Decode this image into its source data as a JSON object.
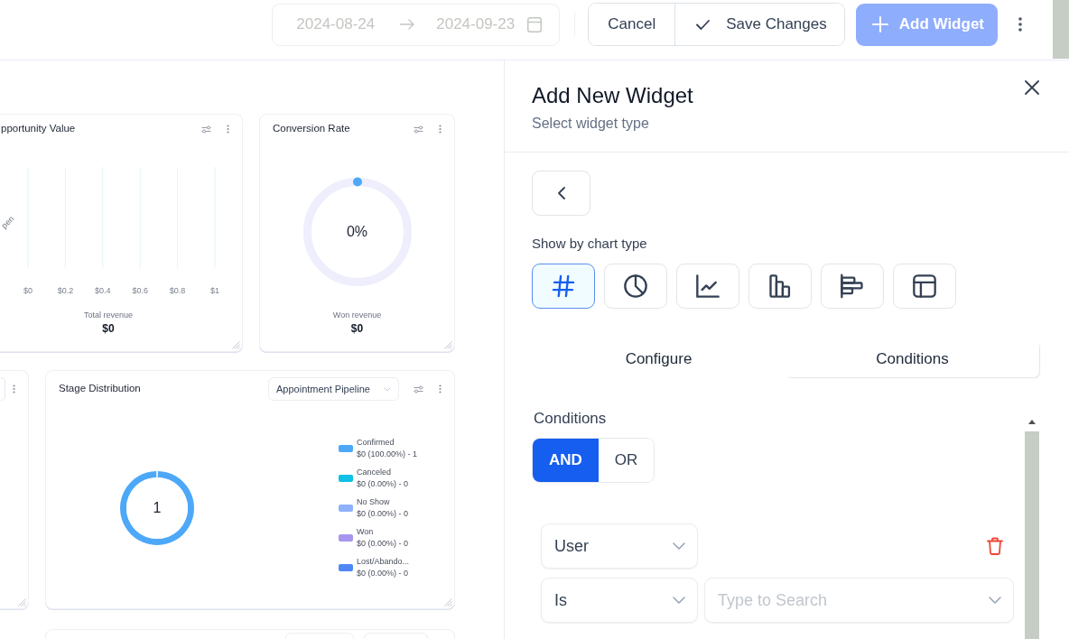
{
  "toolbar": {
    "date_range": {
      "start": "2024-08-24",
      "end": "2024-09-23",
      "disabled": true
    },
    "edit_buttons": [
      {
        "label": "Cancel",
        "kind": "text"
      },
      {
        "label": "Save Changes",
        "kind": "check"
      }
    ],
    "add_button": {
      "label": "Add Widget",
      "disabled": true
    }
  },
  "dashboard": {
    "rows": [
      [
        {
          "kind": "bar",
          "title": "pportunity Value",
          "chart_data": {
            "type": "bar",
            "orientation": "horizontal",
            "grid": true,
            "categories": [
              "pen"
            ],
            "values": [
              0
            ],
            "xlim": [
              0,
              1
            ],
            "xticks": [
              {
                "value": 0,
                "label": "$0"
              },
              {
                "value": 0.2,
                "label": "$0.2"
              },
              {
                "value": 0.4,
                "label": "$0.4"
              },
              {
                "value": 0.6,
                "label": "$0.6"
              },
              {
                "value": 0.8,
                "label": "$0.8"
              },
              {
                "value": 1,
                "label": "$1"
              }
            ]
          },
          "caption": "Total revenue",
          "value": "$0"
        },
        {
          "kind": "gauge",
          "title": "Conversion Rate",
          "reading": "0%",
          "caption": "Won revenue",
          "value": "$0"
        }
      ],
      [
        {
          "kind": "cut"
        },
        {
          "kind": "donut",
          "title": "Stage Distribution",
          "pipeline": "Appointment Pipeline",
          "total": "1",
          "chart_data": {
            "type": "donut",
            "categories": [
              "Confirmed",
              "Canceled",
              "No Show",
              "Won",
              "Lost/Abando..."
            ],
            "values": [
              1,
              0,
              0,
              0,
              0
            ]
          },
          "legend": [
            {
              "color": "#4ea8f8",
              "detail": "$0 (100.00%) - 1"
            },
            {
              "color": "#10c0e5",
              "detail": "$0 (0.00%) - 0"
            },
            {
              "color": "#8fb1fb",
              "detail": "$0 (0.00%) - 0"
            },
            {
              "color": "#a896ee",
              "detail": "$0 (0.00%) - 0"
            },
            {
              "color": "#4f88f5",
              "detail": "$0 (0.00%) - 0"
            }
          ]
        }
      ],
      [
        {
          "kind": "controls"
        }
      ]
    ]
  },
  "panel": {
    "title": "Add New Widget",
    "subtitle": "Select widget type",
    "chart_type_label": "Show by chart type",
    "chart_types": [
      {
        "kind": "number",
        "selected": true
      },
      {
        "kind": "pie",
        "selected": false
      },
      {
        "kind": "line",
        "selected": false
      },
      {
        "kind": "column",
        "selected": false
      },
      {
        "kind": "bar",
        "selected": false
      },
      {
        "kind": "table",
        "selected": false
      }
    ],
    "tabs": [
      {
        "label": "Configure",
        "selected": false
      },
      {
        "label": "Conditions",
        "selected": true
      }
    ],
    "conditions": {
      "heading": "Conditions",
      "operators": [
        {
          "label": "AND",
          "selected": true
        },
        {
          "label": "OR",
          "selected": false
        }
      ],
      "rows": [
        {
          "fields": [
            {
              "value": "User"
            }
          ],
          "deletable": true
        },
        {
          "fields": [
            {
              "value": "Is"
            },
            {
              "placeholder": "Type to Search"
            }
          ],
          "deletable": false
        }
      ]
    }
  }
}
